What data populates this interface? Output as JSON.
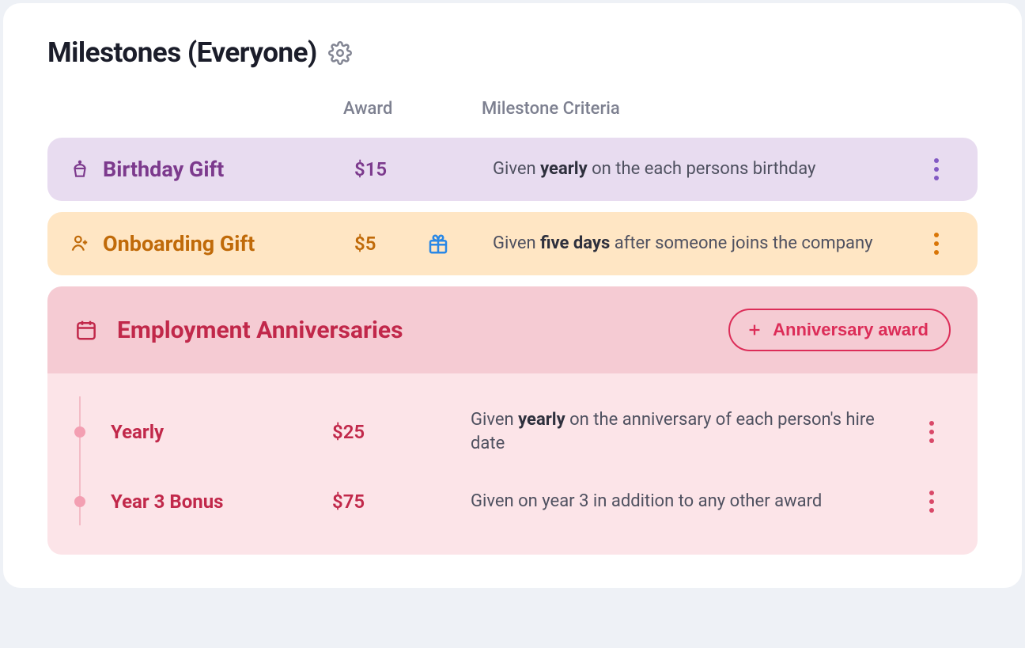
{
  "header": {
    "title": "Milestones (Everyone)"
  },
  "columns": {
    "award": "Award",
    "criteria": "Milestone Criteria"
  },
  "rows": {
    "birthday": {
      "name": "Birthday Gift",
      "award": "$15",
      "criteria_pre": "Given ",
      "criteria_bold": "yearly",
      "criteria_post": " on the each persons birthday"
    },
    "onboarding": {
      "name": "Onboarding Gift",
      "award": "$5",
      "criteria_pre": "Given ",
      "criteria_bold": "five days",
      "criteria_post": " after someone joins the company"
    }
  },
  "anniversaries": {
    "title": "Employment Anniversaries",
    "add_label": "Anniversary award",
    "items": [
      {
        "name": "Yearly",
        "award": "$25",
        "criteria_pre": "Given ",
        "criteria_bold": "yearly",
        "criteria_post": " on the anniversary of each person's hire date"
      },
      {
        "name": "Year 3 Bonus",
        "award": "$75",
        "criteria_pre": "Given on year 3 in addition to any other award",
        "criteria_bold": "",
        "criteria_post": ""
      }
    ]
  },
  "colors": {
    "purple": "#7c3a8d",
    "orange": "#c06a09",
    "red": "#c1284a"
  }
}
